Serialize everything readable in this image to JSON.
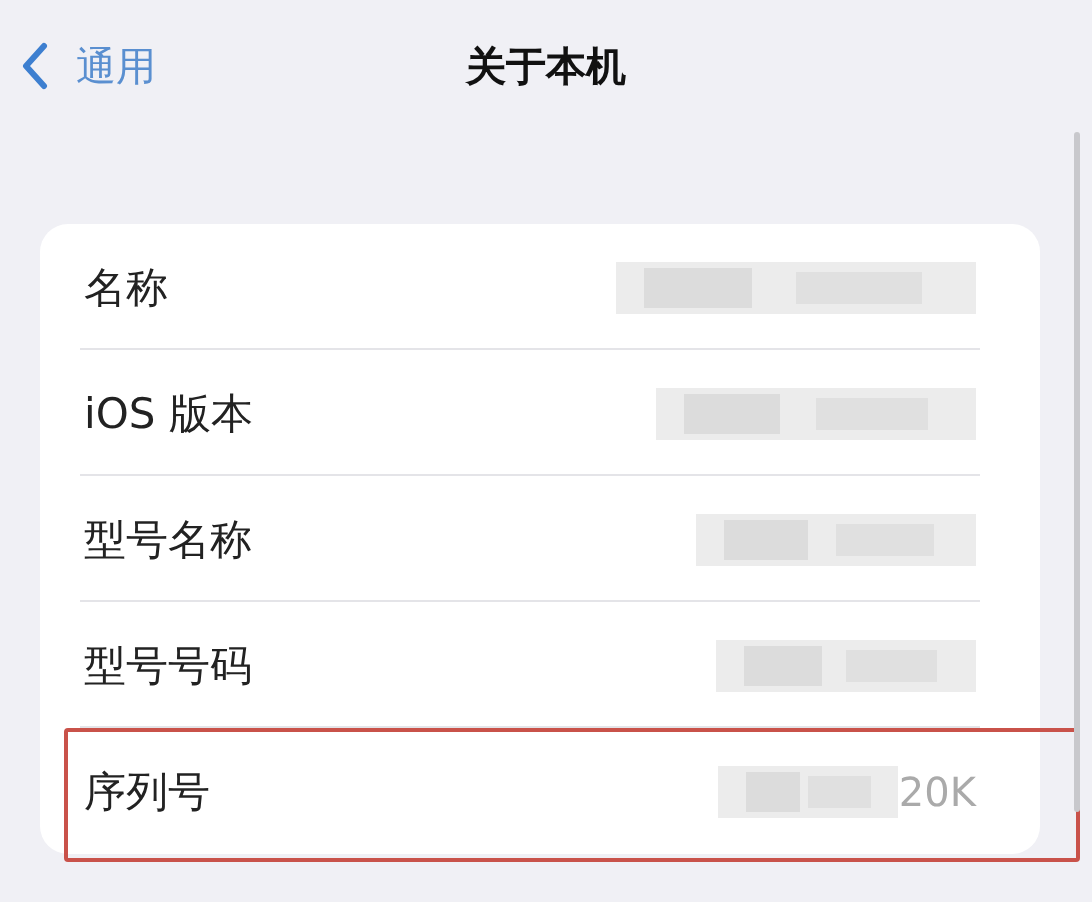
{
  "nav": {
    "back": "通用",
    "title": "关于本机"
  },
  "rows": [
    {
      "label": "名称",
      "highlighted": false
    },
    {
      "label": "iOS 版本",
      "highlighted": false
    },
    {
      "label": "型号名称",
      "highlighted": false
    },
    {
      "label": "型号号码",
      "highlighted": false
    },
    {
      "label": "序列号",
      "value": "20K",
      "highlighted": true
    }
  ]
}
